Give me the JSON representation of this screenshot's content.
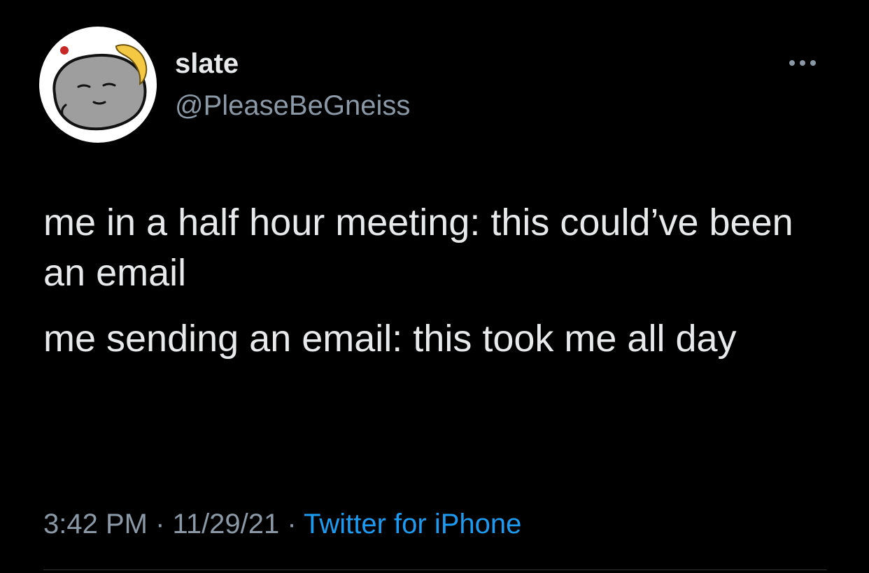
{
  "tweet": {
    "author": {
      "display_name": "slate",
      "handle": "@PleaseBeGneiss",
      "avatar_icon": "rock-with-banana-avatar"
    },
    "more_icon": "more-options-icon",
    "paragraphs": [
      "me in a half hour meeting: this could’ve been an email",
      "me sending an email: this took me all day"
    ],
    "time": "3:42 PM",
    "separator": "·",
    "date": "11/29/21",
    "source": "Twitter for iPhone",
    "colors": {
      "background": "#000000",
      "primary_text": "#e7e9ea",
      "secondary_text": "#8b98a5",
      "link": "#1d9bf0"
    }
  }
}
